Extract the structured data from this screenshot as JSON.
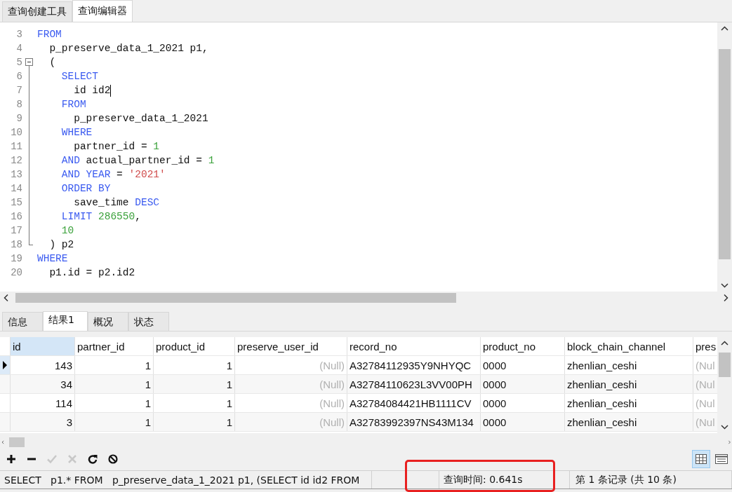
{
  "top_tabs": [
    {
      "label": "查询创建工具",
      "selected": false
    },
    {
      "label": "查询编辑器",
      "selected": true
    }
  ],
  "editor": {
    "lines": [
      {
        "no": "3",
        "tokens": [
          {
            "t": "FROM",
            "kind": "kw"
          }
        ]
      },
      {
        "no": "4",
        "tokens": [
          {
            "t": "  p_preserve_data_1_2021 p1,",
            "kind": "plain"
          }
        ]
      },
      {
        "no": "5",
        "tokens": [
          {
            "t": "  (",
            "kind": "plain"
          }
        ]
      },
      {
        "no": "6",
        "tokens": [
          {
            "t": "    SELECT",
            "kind": "kw"
          }
        ]
      },
      {
        "no": "7",
        "caret": true,
        "tokens": [
          {
            "t": "      id id2",
            "kind": "plain"
          }
        ]
      },
      {
        "no": "8",
        "tokens": [
          {
            "t": "    FROM",
            "kind": "kw"
          }
        ]
      },
      {
        "no": "9",
        "tokens": [
          {
            "t": "      p_preserve_data_1_2021",
            "kind": "plain"
          }
        ]
      },
      {
        "no": "10",
        "tokens": [
          {
            "t": "    WHERE",
            "kind": "kw"
          }
        ]
      },
      {
        "no": "11",
        "tokens": [
          {
            "t": "      partner_id = ",
            "kind": "plain"
          },
          {
            "t": "1",
            "kind": "num"
          }
        ]
      },
      {
        "no": "12",
        "tokens": [
          {
            "t": "    AND",
            "kind": "kw"
          },
          {
            "t": " actual_partner_id = ",
            "kind": "plain"
          },
          {
            "t": "1",
            "kind": "num"
          }
        ]
      },
      {
        "no": "13",
        "tokens": [
          {
            "t": "    AND YEAR",
            "kind": "kw"
          },
          {
            "t": " = ",
            "kind": "plain"
          },
          {
            "t": "'2021'",
            "kind": "str"
          }
        ]
      },
      {
        "no": "14",
        "tokens": [
          {
            "t": "    ORDER BY",
            "kind": "kw"
          }
        ]
      },
      {
        "no": "15",
        "tokens": [
          {
            "t": "      save_time ",
            "kind": "plain"
          },
          {
            "t": "DESC",
            "kind": "kw"
          }
        ]
      },
      {
        "no": "16",
        "tokens": [
          {
            "t": "    LIMIT ",
            "kind": "kw"
          },
          {
            "t": "286550",
            "kind": "num"
          },
          {
            "t": ",",
            "kind": "plain"
          }
        ]
      },
      {
        "no": "17",
        "tokens": [
          {
            "t": "    10",
            "kind": "num"
          }
        ]
      },
      {
        "no": "18",
        "tokens": [
          {
            "t": "  ) p2",
            "kind": "plain"
          }
        ]
      },
      {
        "no": "19",
        "tokens": [
          {
            "t": "WHERE",
            "kind": "kw"
          }
        ]
      },
      {
        "no": "20",
        "tokens": [
          {
            "t": "  p1.id = p2.id2",
            "kind": "plain"
          }
        ]
      }
    ],
    "fold_region": {
      "expanded": true
    }
  },
  "result_tabs": [
    {
      "label": "信息",
      "selected": false
    },
    {
      "label": "结果1",
      "selected": true
    },
    {
      "label": "概况",
      "selected": false
    },
    {
      "label": "状态",
      "selected": false
    }
  ],
  "table": {
    "columns": [
      {
        "label": "id",
        "selected": true
      },
      {
        "label": "partner_id",
        "selected": false
      },
      {
        "label": "product_id",
        "selected": false
      },
      {
        "label": "preserve_user_id",
        "selected": false
      },
      {
        "label": "record_no",
        "selected": false
      },
      {
        "label": "product_no",
        "selected": false
      },
      {
        "label": "block_chain_channel",
        "selected": false
      },
      {
        "label": "pres",
        "selected": false
      }
    ],
    "rows": [
      {
        "current": true,
        "cells": [
          {
            "v": "143",
            "null": false
          },
          {
            "v": "1",
            "null": false
          },
          {
            "v": "1",
            "null": false
          },
          {
            "v": "(Null)",
            "null": true
          },
          {
            "v": "A32784112935Y9NHYQC",
            "null": false
          },
          {
            "v": "0000",
            "null": false
          },
          {
            "v": "zhenlian_ceshi",
            "null": false
          },
          {
            "v": "(Nul",
            "null": true
          }
        ]
      },
      {
        "current": false,
        "cells": [
          {
            "v": "34",
            "null": false
          },
          {
            "v": "1",
            "null": false
          },
          {
            "v": "1",
            "null": false
          },
          {
            "v": "(Null)",
            "null": true
          },
          {
            "v": "A32784110623L3VV00PH",
            "null": false
          },
          {
            "v": "0000",
            "null": false
          },
          {
            "v": "zhenlian_ceshi",
            "null": false
          },
          {
            "v": "(Nul",
            "null": true
          }
        ]
      },
      {
        "current": false,
        "cells": [
          {
            "v": "114",
            "null": false
          },
          {
            "v": "1",
            "null": false
          },
          {
            "v": "1",
            "null": false
          },
          {
            "v": "(Null)",
            "null": true
          },
          {
            "v": "A32784084421HB1111CV",
            "null": false
          },
          {
            "v": "0000",
            "null": false
          },
          {
            "v": "zhenlian_ceshi",
            "null": false
          },
          {
            "v": "(Nul",
            "null": true
          }
        ]
      },
      {
        "current": false,
        "cells": [
          {
            "v": "3",
            "null": false
          },
          {
            "v": "1",
            "null": false
          },
          {
            "v": "1",
            "null": false
          },
          {
            "v": "(Null)",
            "null": true
          },
          {
            "v": "A32783992397NS43M134",
            "null": false
          },
          {
            "v": "0000",
            "null": false
          },
          {
            "v": "zhenlian_ceshi",
            "null": false
          },
          {
            "v": "(Nul",
            "null": true
          }
        ]
      }
    ]
  },
  "toolbar": [
    {
      "kind": "add",
      "disabled": false
    },
    {
      "kind": "remove",
      "disabled": false
    },
    {
      "kind": "apply",
      "disabled": true
    },
    {
      "kind": "cancel",
      "disabled": true
    },
    {
      "kind": "refresh",
      "disabled": false
    },
    {
      "kind": "stop",
      "disabled": false
    }
  ],
  "view_toggles": [
    {
      "kind": "grid",
      "selected": true
    },
    {
      "kind": "form",
      "selected": false
    }
  ],
  "status_bar": {
    "sql": "SELECT   p1.* FROM   p_preserve_data_1_2021 p1, (SELECT id id2 FROM",
    "query_time": "查询时间: 0.641s",
    "record": "第 1 条记录 (共 10 条)",
    "highlight": true
  }
}
